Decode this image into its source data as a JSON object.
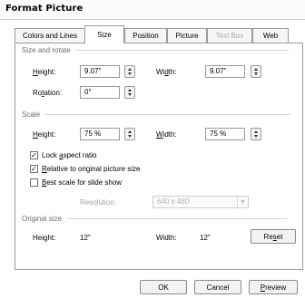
{
  "window": {
    "title": "Format Picture"
  },
  "tabs": [
    {
      "label": "Colors and Lines"
    },
    {
      "label": "Size"
    },
    {
      "label": "Position"
    },
    {
      "label": "Picture"
    },
    {
      "label": "Text Box"
    },
    {
      "label": "Web"
    }
  ],
  "size_and_rotate": {
    "heading": "Size and rotate",
    "height_label": "Height:",
    "height_value": "9.07\"",
    "width_label": "Width:",
    "width_value": "9.07\"",
    "rotation_label": "Rotation:",
    "rotation_value": "0°"
  },
  "scale": {
    "heading": "Scale",
    "height_label": "Height:",
    "height_value": "75 %",
    "width_label": "Width:",
    "width_value": "75 %",
    "lock_aspect_label": "Lock aspect ratio",
    "lock_aspect_checked": true,
    "relative_label": "Relative to original picture size",
    "relative_checked": true,
    "best_scale_label": "Best scale for slide show",
    "best_scale_checked": false,
    "resolution_label": "Resolution:",
    "resolution_value": "640 x 480"
  },
  "original_size": {
    "heading": "Original size",
    "height_label": "Height:",
    "height_value": "12\"",
    "width_label": "Width:",
    "width_value": "12\"",
    "reset_label": "Reset"
  },
  "buttons": {
    "ok": "OK",
    "cancel": "Cancel",
    "preview": "Preview"
  },
  "glyphs": {
    "check": "✓",
    "dropdown": "▼"
  }
}
